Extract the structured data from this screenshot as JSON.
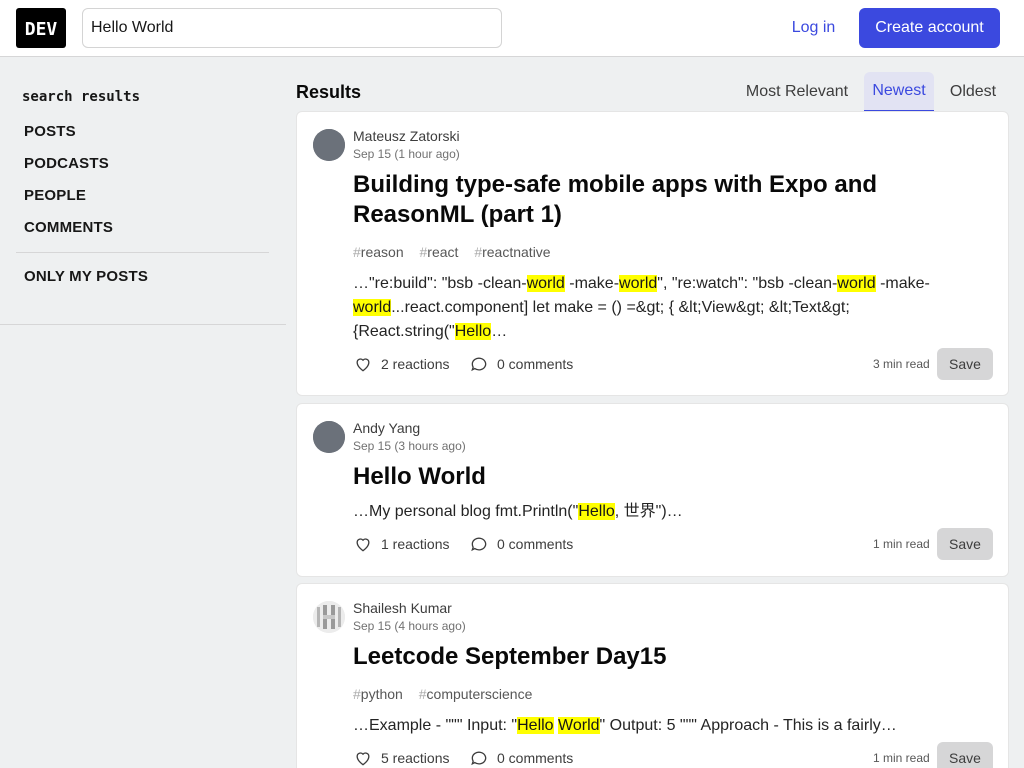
{
  "header": {
    "logo_text": "DEV",
    "search_value": "Hello World",
    "login_label": "Log in",
    "create_label": "Create account"
  },
  "sidebar": {
    "title": "search results",
    "items": [
      "POSTS",
      "PODCASTS",
      "PEOPLE",
      "COMMENTS"
    ],
    "only_mine": "ONLY MY POSTS"
  },
  "results": {
    "title": "Results",
    "sort_tabs": [
      "Most Relevant",
      "Newest",
      "Oldest"
    ],
    "active_tab": "Newest"
  },
  "posts": [
    {
      "author": "Mateusz Zatorski",
      "date": "Sep 15 (1 hour ago)",
      "title": "Building type-safe mobile apps with Expo and ReasonML (part 1)",
      "tags": [
        "reason",
        "react",
        "reactnative"
      ],
      "snippet_html": "…\"re:build\": \"bsb -clean-<mark>world</mark> -make-<mark>world</mark>\", \"re:watch\": \"bsb -clean-<mark>world</mark> -make-<mark>world</mark>...react.component] let make = () =&amp;gt; { &amp;lt;View&amp;gt; &amp;lt;Text&amp;gt; {React.string(\"<mark>Hello</mark>…",
      "reactions": "2 reactions",
      "comments": "0 comments",
      "read_time": "3 min read",
      "save_label": "Save"
    },
    {
      "author": "Andy Yang",
      "date": "Sep 15 (3 hours ago)",
      "title": "Hello World",
      "tags": [],
      "snippet_html": "…My personal blog fmt.Println(\"<mark>Hello</mark>, 世界\")…",
      "reactions": "1 reactions",
      "comments": "0 comments",
      "read_time": "1 min read",
      "save_label": "Save"
    },
    {
      "author": "Shailesh Kumar",
      "date": "Sep 15 (4 hours ago)",
      "title": "Leetcode September Day15",
      "tags": [
        "python",
        "computerscience"
      ],
      "snippet_html": "…Example - \"\"\" Input: \"<mark>Hello</mark> <mark>World</mark>\" Output: 5 \"\"\" Approach - This is a fairly…",
      "reactions": "5 reactions",
      "comments": "0 comments",
      "read_time": "1 min read",
      "save_label": "Save"
    }
  ],
  "colors": {
    "accent": "#3b49df",
    "highlight": "#ffff00",
    "page_bg": "#eef0f1"
  }
}
